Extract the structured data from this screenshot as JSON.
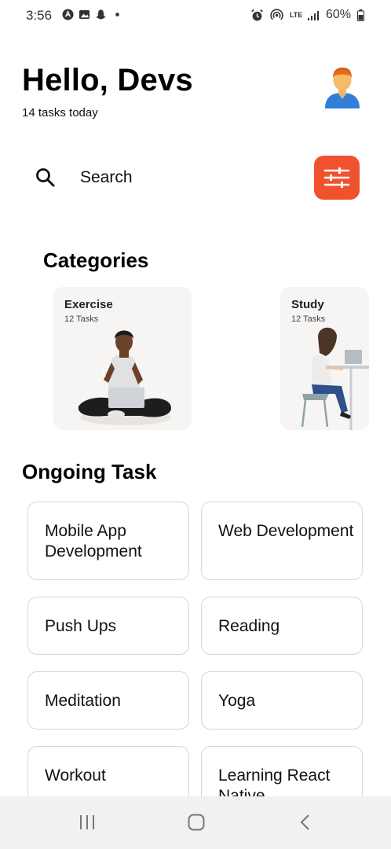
{
  "status_bar": {
    "time": "3:56",
    "battery": "60%",
    "network": "LTE"
  },
  "header": {
    "greeting": "Hello, Devs",
    "subtitle": "14 tasks today",
    "avatar_icon": "person-avatar-icon"
  },
  "search": {
    "placeholder": "Search",
    "value": "",
    "filter_icon": "sliders-icon",
    "filter_color": "#F0522E"
  },
  "categories": {
    "title": "Categories",
    "items": [
      {
        "name": "Exercise",
        "count": "12 Tasks"
      },
      {
        "name": "Study",
        "count": "12 Tasks"
      }
    ]
  },
  "ongoing": {
    "title": "Ongoing Task",
    "items": [
      {
        "label": "Mobile App Development"
      },
      {
        "label": "Web Development"
      },
      {
        "label": "Push Ups"
      },
      {
        "label": "Reading"
      },
      {
        "label": "Meditation"
      },
      {
        "label": "Yoga"
      },
      {
        "label": "Workout"
      },
      {
        "label": "Learning React Native"
      }
    ]
  },
  "nav": {
    "recents_icon": "recents-icon",
    "home_icon": "home-icon",
    "back_icon": "back-icon"
  }
}
